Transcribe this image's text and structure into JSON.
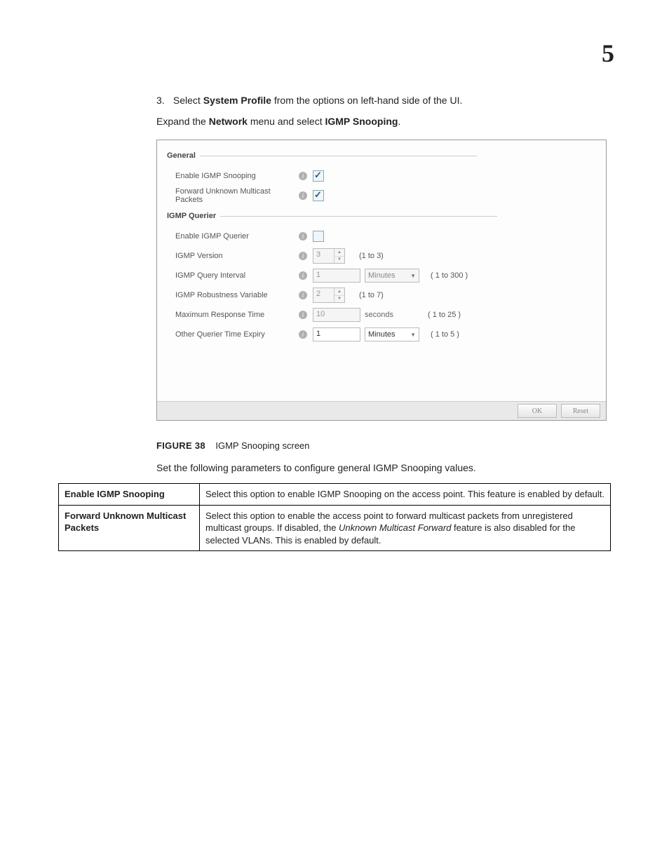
{
  "page_number": "5",
  "step": {
    "number": "3.",
    "pre": "Select ",
    "bold": "System Profile",
    "post": " from the options on left-hand side of the UI."
  },
  "expand": {
    "pre": "Expand the ",
    "b1": "Network",
    "mid": " menu and select ",
    "b2": "IGMP Snooping",
    "post": "."
  },
  "panel": {
    "sections": {
      "general": "General",
      "querier": "IGMP Querier"
    },
    "rows": {
      "enable_snooping": "Enable IGMP Snooping",
      "forward_unknown": "Forward Unknown Multicast Packets",
      "enable_querier": "Enable IGMP Querier",
      "igmp_version": "IGMP Version",
      "query_interval": "IGMP Query Interval",
      "robustness": "IGMP Robustness Variable",
      "max_response": "Maximum Response Time",
      "other_expiry": "Other Querier Time Expiry"
    },
    "values": {
      "igmp_version": "3",
      "query_interval": "1",
      "robustness": "2",
      "max_response": "10",
      "other_expiry": "1"
    },
    "units": {
      "query_interval": "Minutes",
      "max_response": "seconds",
      "other_expiry": "Minutes"
    },
    "ranges": {
      "igmp_version": "(1 to 3)",
      "query_interval": "( 1 to 300 )",
      "robustness": "(1 to 7)",
      "max_response": "( 1 to 25 )",
      "other_expiry": "( 1 to 5 )"
    },
    "buttons": {
      "ok": "OK",
      "reset": "Reset"
    }
  },
  "figure": {
    "label": "FIGURE 38",
    "caption": "IGMP Snooping screen"
  },
  "set_line": "Set the following parameters to configure general IGMP Snooping values.",
  "table": {
    "r1h": "Enable IGMP Snooping",
    "r1d": "Select this option to enable IGMP Snooping on the access point. This feature is enabled by default.",
    "r2h": "Forward Unknown Multicast Packets",
    "r2d_pre": "Select this option to enable the access point to forward multicast packets from unregistered multicast groups. If disabled, the ",
    "r2d_i": "Unknown Multicast Forward",
    "r2d_post": " feature is also disabled for the selected VLANs. This is enabled by default."
  }
}
